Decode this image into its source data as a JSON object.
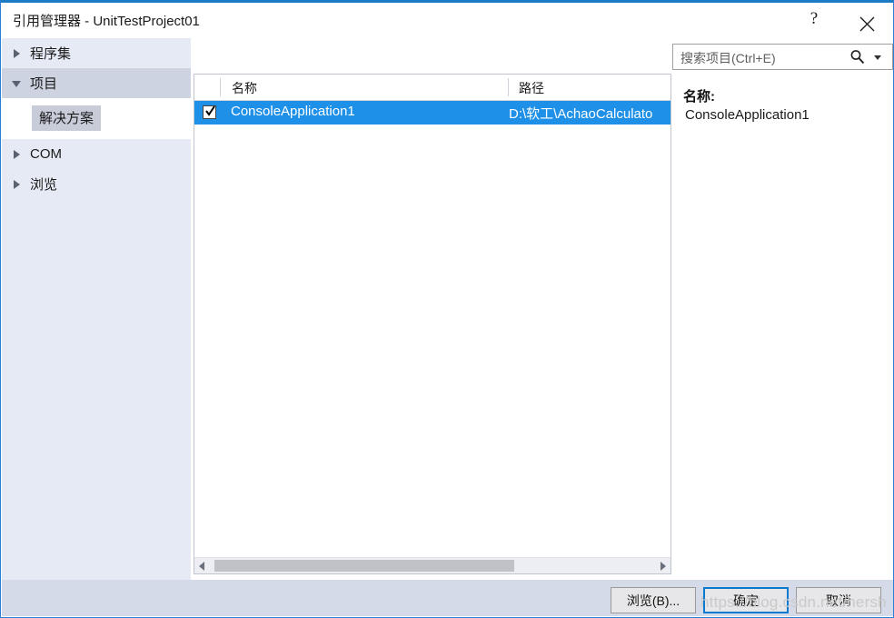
{
  "window": {
    "title": "引用管理器 - UnitTestProject01",
    "help_button": "?",
    "close_button": "×"
  },
  "sidebar": {
    "items": [
      {
        "label": "程序集",
        "state": "collapsed",
        "selected": false
      },
      {
        "label": "项目",
        "state": "expanded",
        "selected": true
      },
      {
        "label": "解决方案",
        "state": "leaf",
        "selected": true
      },
      {
        "label": "COM",
        "state": "collapsed",
        "selected": false
      },
      {
        "label": "浏览",
        "state": "collapsed",
        "selected": false
      }
    ]
  },
  "search": {
    "placeholder": "搜索项目(Ctrl+E)",
    "value": "",
    "icon": "search-icon",
    "dropdown_icon": "chevron-down-icon"
  },
  "list": {
    "columns": [
      "名称",
      "路径"
    ],
    "rows": [
      {
        "checked": true,
        "name": "ConsoleApplication1",
        "path": "D:\\软工\\AchaoCalculato"
      }
    ]
  },
  "detail": {
    "name_label": "名称:",
    "name_value": "ConsoleApplication1"
  },
  "footer": {
    "browse_label": "浏览(B)...",
    "ok_label": "确定",
    "cancel_label": "取消"
  },
  "watermark": {
    "text": "https://blog.csdn.net/hersh"
  },
  "colors": {
    "accent": "#1e90e8",
    "window_border": "#2a7fd4",
    "sidebar_bg": "#e6eaf4",
    "sidebar_selected": "#cdd3e0",
    "footer_bg": "#d4dae8",
    "focus_border": "#0a7ad0"
  }
}
